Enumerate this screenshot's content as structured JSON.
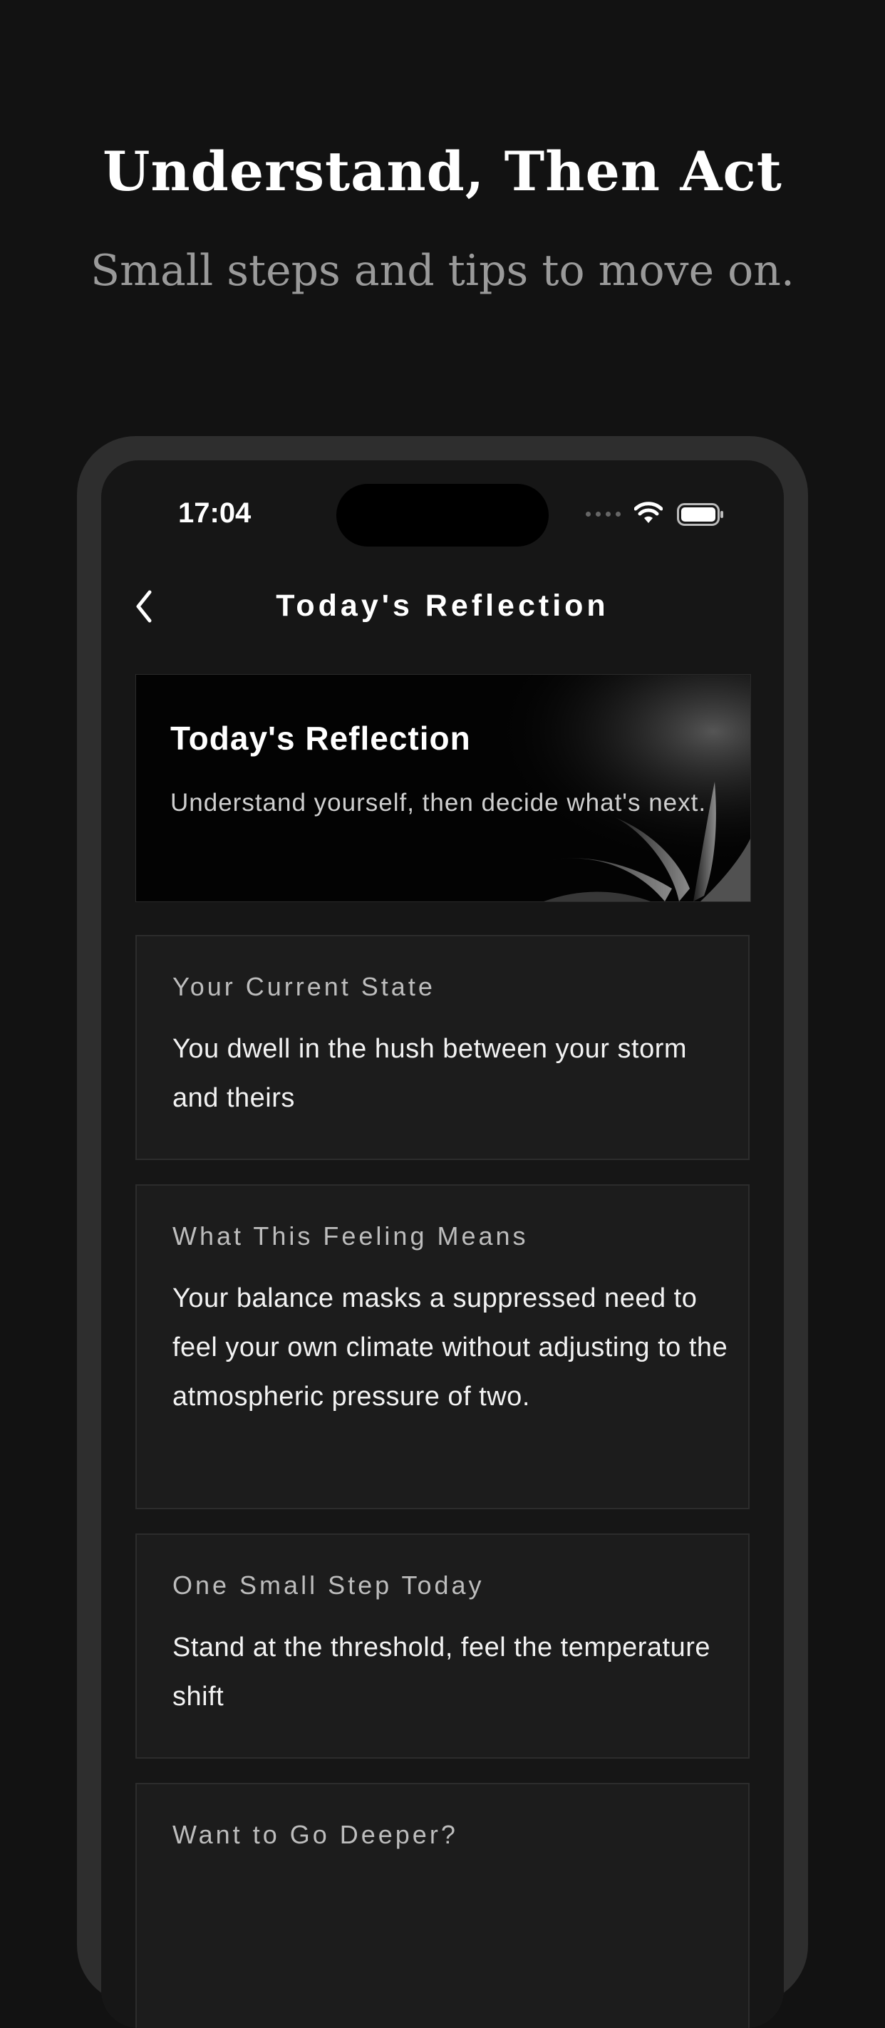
{
  "marketing": {
    "headline": "Understand, Then Act",
    "subheadline": "Small steps and tips to move on."
  },
  "status_bar": {
    "time": "17:04",
    "icons": [
      "cellular-dots-icon",
      "wifi-icon",
      "battery-icon"
    ]
  },
  "nav": {
    "back_icon": "chevron-left-icon",
    "title": "Today's Reflection"
  },
  "hero": {
    "title": "Today's Reflection",
    "subtitle": "Understand yourself, then decide what's next."
  },
  "cards": [
    {
      "label": "Your Current State",
      "body": "You dwell in the hush between your storm and theirs"
    },
    {
      "label": "What This Feeling Means",
      "body": "Your balance masks a suppressed need to feel your own climate without adjusting to the atmospheric pressure of two."
    },
    {
      "label": "One Small Step Today",
      "body": "Stand at the threshold, feel the temperature shift"
    },
    {
      "label": "Want to Go Deeper?",
      "body": ""
    }
  ],
  "colors": {
    "background": "#121212",
    "phone_frame": "#2e2e2e",
    "screen": "#161616",
    "card": "#1c1c1c",
    "text_primary": "#ffffff",
    "text_secondary": "#9a9a9a"
  }
}
